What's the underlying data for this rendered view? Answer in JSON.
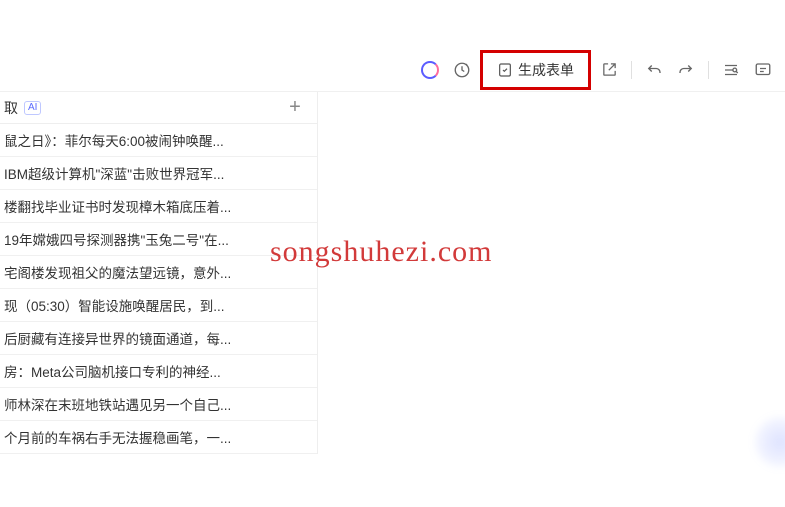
{
  "toolbar": {
    "generate_form_label": "生成表单"
  },
  "sidebar": {
    "header_label": "取",
    "ai_badge": "AI",
    "items": [
      "鼠之日》：菲尔每天6:00被闹钟唤醒...",
      "IBM超级计算机\"深蓝\"击败世界冠军...",
      "楼翻找毕业证书时发现樟木箱底压着...",
      "19年嫦娥四号探测器携\"玉兔二号\"在...",
      "宅阁楼发现祖父的魔法望远镜，意外...",
      "现（05:30）智能设施唤醒居民，到...",
      "后厨藏有连接异世界的镜面通道，每...",
      "房：Meta公司脑机接口专利的神经...",
      "师林深在末班地铁站遇见另一个自己...",
      "个月前的车祸右手无法握稳画笔，一..."
    ]
  },
  "watermark": "songshuhezi.com"
}
